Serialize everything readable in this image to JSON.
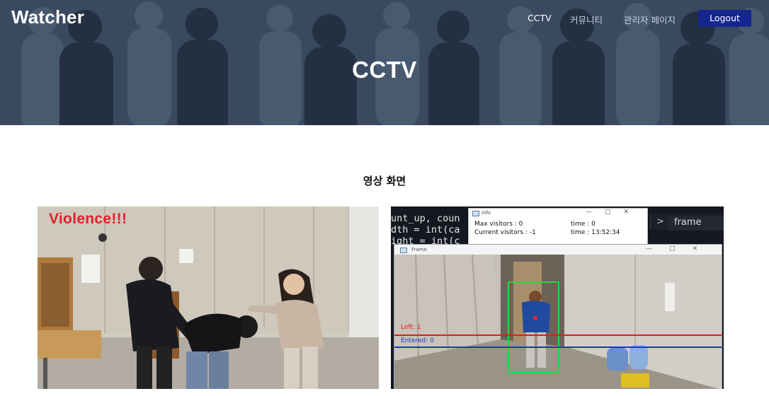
{
  "nav": {
    "brand": "Watcher",
    "links": [
      "CCTV",
      "커뮤니티",
      "관리자 페이지"
    ],
    "logout_label": "Logout"
  },
  "hero": {
    "title": "CCTV"
  },
  "section": {
    "title": "영상 화면"
  },
  "video_left": {
    "overlay_text": "Violence!!!"
  },
  "video_right": {
    "code_lines": [
      "unt_up, coun",
      "dth = int(ca",
      "ight = int(c"
    ],
    "terminal_text": "frame",
    "info_window": {
      "title": "info",
      "max_visitors": "Max visitors : 0",
      "current_visitors": "Current visitors : -1",
      "time_top": "time : 0",
      "time_bottom": "time : 13:52:34"
    },
    "frame_window": {
      "title": "Frame",
      "left_label": "Left: 1",
      "entered_label": "Entered: 0"
    }
  },
  "colors": {
    "hero_bg": "#3c4e66",
    "logout_bg": "#16268e",
    "violence_red": "#e3202a",
    "detect_box": "#22d93a",
    "line_red": "#e01e1e",
    "line_blue": "#1733d8"
  },
  "icons": {
    "window_icon": "app-window-icon",
    "window_controls": "minimize-maximize-close-icons"
  }
}
